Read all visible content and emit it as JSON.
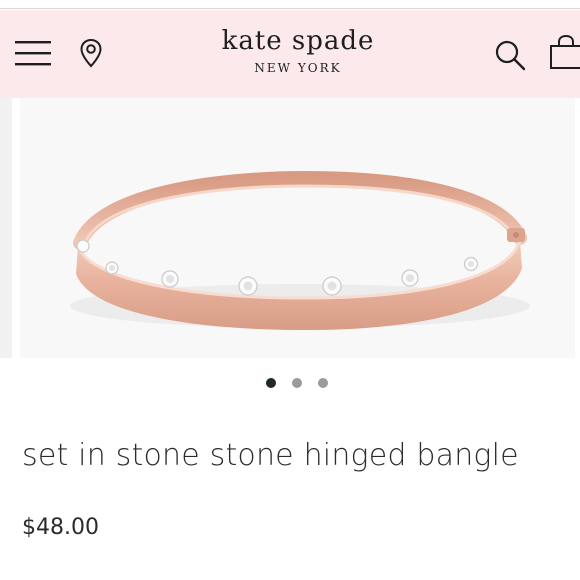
{
  "header": {
    "brand_name": "kate spade",
    "brand_city": "NEW YORK",
    "icons": [
      "menu-icon",
      "location-pin-icon",
      "search-icon",
      "shopping-bag-icon"
    ],
    "background": "#fbe9ec"
  },
  "gallery": {
    "image_subject": "rose gold hinged bangle with set stones",
    "carousel": {
      "count": 3,
      "active_index": 0
    }
  },
  "product": {
    "title": "set in stone stone hinged bangle",
    "price": "$48.00"
  },
  "colors": {
    "accent_dark": "#1d2a26",
    "rose_gold": "#e9b7a3",
    "text": "#2b2b2b"
  }
}
